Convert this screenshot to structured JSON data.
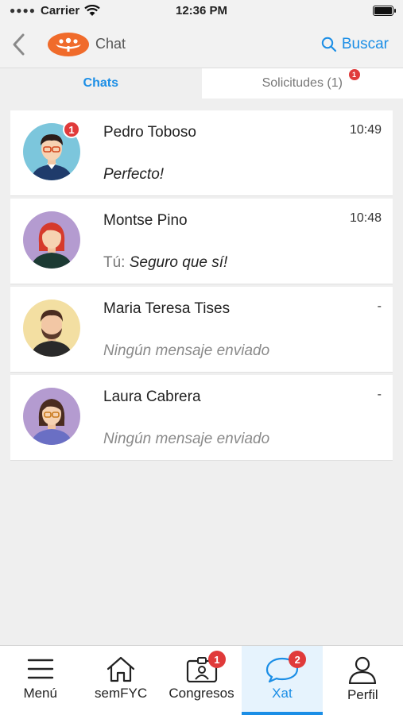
{
  "status_bar": {
    "carrier": "Carrier",
    "time": "12:36 PM"
  },
  "nav": {
    "title": "Chat",
    "search_label": "Buscar"
  },
  "tabs": [
    {
      "label": "Chats",
      "active": true
    },
    {
      "label": "Solicitudes (1)",
      "active": false,
      "badge": "1"
    }
  ],
  "chats": [
    {
      "name": "Pedro Toboso",
      "time": "10:49",
      "prefix": "",
      "message": "Perfecto!",
      "badge": "1",
      "avatar": "male-glasses-avatar"
    },
    {
      "name": "Montse Pino",
      "time": "10:48",
      "prefix": "Tú: ",
      "message": "Seguro que sí!",
      "avatar": "female-redhair-avatar"
    },
    {
      "name": "Maria Teresa Tises",
      "time": "-",
      "prefix": "",
      "message": "Ningún mensaje enviado",
      "avatar": "male-beard-avatar"
    },
    {
      "name": "Laura Cabrera",
      "time": "-",
      "prefix": "",
      "message": "Ningún mensaje enviado",
      "avatar": "female-glasses-avatar"
    }
  ],
  "tab_bar": [
    {
      "label": "Menú",
      "icon": "menu-icon"
    },
    {
      "label": "semFYC",
      "icon": "home-icon"
    },
    {
      "label": "Congresos",
      "icon": "badge-icon",
      "badge": "1"
    },
    {
      "label": "Xat",
      "icon": "chat-bubble-icon",
      "badge": "2",
      "active": true
    },
    {
      "label": "Perfil",
      "icon": "user-icon"
    }
  ],
  "colors": {
    "accent": "#1b8ee6",
    "badge": "#e03a3a",
    "logo": "#f06b2b"
  }
}
